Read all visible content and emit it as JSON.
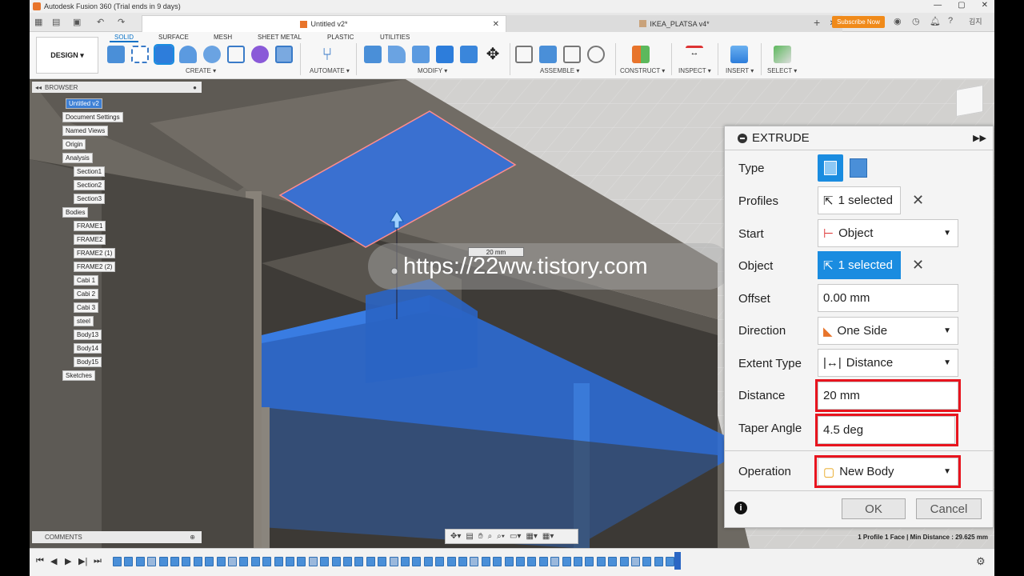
{
  "title_bar": {
    "text": "Autodesk Fusion 360 (Trial ends in 9 days)"
  },
  "tabs": [
    {
      "label": "Untitled v2*"
    },
    {
      "label": "IKEA_PLATSA v4*"
    }
  ],
  "subscribe_label": "Subscribe Now",
  "user_label": "김지",
  "design_label": "DESIGN ▾",
  "ribbon_tabs": [
    "SOLID",
    "SURFACE",
    "MESH",
    "SHEET METAL",
    "PLASTIC",
    "UTILITIES"
  ],
  "ribbon_groups": [
    "CREATE ▾",
    "AUTOMATE ▾",
    "MODIFY ▾",
    "ASSEMBLE ▾",
    "CONSTRUCT ▾",
    "INSPECT ▾",
    "INSERT ▾",
    "SELECT ▾"
  ],
  "browser": {
    "title": "BROWSER",
    "items": [
      "Untitled v2",
      "Document Settings",
      "Named Views",
      "Origin",
      "Analysis",
      "Section1",
      "Section2",
      "Section3",
      "Bodies",
      "FRAME1",
      "FRAME2",
      "FRAME2 (1)",
      "FRAME2 (2)",
      "Cabi 1",
      "Cabi 2",
      "Cabi 3",
      "steel",
      "Body13",
      "Body14",
      "Body15",
      "Sketches"
    ]
  },
  "comments_label": "COMMENTS",
  "dimension_label": "20 mm",
  "watermark": "https://22ww.tistory.com",
  "extrude": {
    "title": "EXTRUDE",
    "type_label": "Type",
    "profiles_label": "Profiles",
    "profiles_value": "1 selected",
    "start_label": "Start",
    "start_value": "Object",
    "object_label": "Object",
    "object_value": "1 selected",
    "offset_label": "Offset",
    "offset_value": "0.00 mm",
    "direction_label": "Direction",
    "direction_value": "One Side",
    "extent_label": "Extent Type",
    "extent_value": "Distance",
    "distance_label": "Distance",
    "distance_value": "20 mm",
    "taper_label": "Taper Angle",
    "taper_value": "4.5 deg",
    "operation_label": "Operation",
    "operation_value": "New Body",
    "ok_label": "OK",
    "cancel_label": "Cancel"
  },
  "status_text": "1 Profile 1 Face | Min Distance : 29.625 mm",
  "colors": {
    "accent": "#1a8ce0",
    "highlight_red": "#e8141e",
    "selection_blue": "#2c6fdc",
    "subscribe": "#f08a1a"
  }
}
